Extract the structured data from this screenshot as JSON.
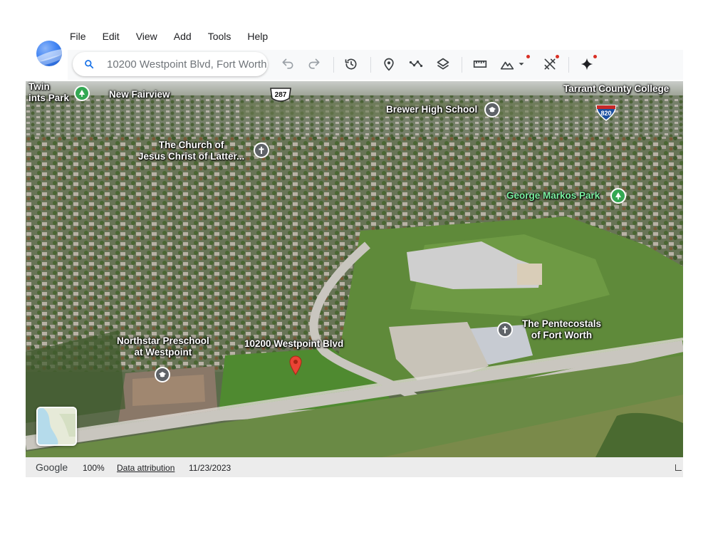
{
  "app": {
    "logo_icon": "google-earth-logo-icon"
  },
  "menu": {
    "items": [
      "File",
      "Edit",
      "View",
      "Add",
      "Tools",
      "Help"
    ]
  },
  "search": {
    "value": "10200 Westpoint Blvd, Fort Worth",
    "icon": "search-icon"
  },
  "toolbar": {
    "buttons": [
      {
        "name": "undo",
        "icon": "undo-icon"
      },
      {
        "name": "redo",
        "icon": "redo-icon"
      },
      {
        "name": "historical-imagery",
        "icon": "history-icon"
      },
      {
        "name": "add-placemark",
        "icon": "placemark-icon"
      },
      {
        "name": "add-path",
        "icon": "path-icon"
      },
      {
        "name": "layers",
        "icon": "layers-icon"
      },
      {
        "name": "measure",
        "icon": "ruler-icon"
      },
      {
        "name": "map-style",
        "icon": "terrain-icon",
        "has_dropdown": true,
        "has_notification_dot": true
      },
      {
        "name": "tools",
        "icon": "tools-icon",
        "has_notification_dot": true
      },
      {
        "name": "gemini",
        "icon": "sparkle-icon",
        "has_notification_dot": true
      }
    ],
    "accent": "#1a73e8",
    "notification_color": "#d93025"
  },
  "map": {
    "labels": {
      "twin_points_park_line1": "Twin",
      "twin_points_park_line2": "ints Park",
      "new_fairview": "New Fairview",
      "highway_287": "287",
      "brewer_high_school": "Brewer High School",
      "tarrant_county_college": "Tarrant County College",
      "interstate_820": "820",
      "church_line1": "The Church of",
      "church_line2": "Jesus Christ of Latter...",
      "george_markos_park": "George Markos Park",
      "pentecostals_line1": "The Pentecostals",
      "pentecostals_line2": "of Fort Worth",
      "northstar_line1": "Northstar Preschool",
      "northstar_line2": "at Westpoint",
      "address_pin": "10200 Westpoint Blvd"
    },
    "poi_colors": {
      "park": "#34a853",
      "place": "#5f6368",
      "pin": "#ea4335"
    }
  },
  "status": {
    "brand": "Google",
    "zoom": "100%",
    "attribution": "Data attribution",
    "date": "11/23/2023"
  }
}
